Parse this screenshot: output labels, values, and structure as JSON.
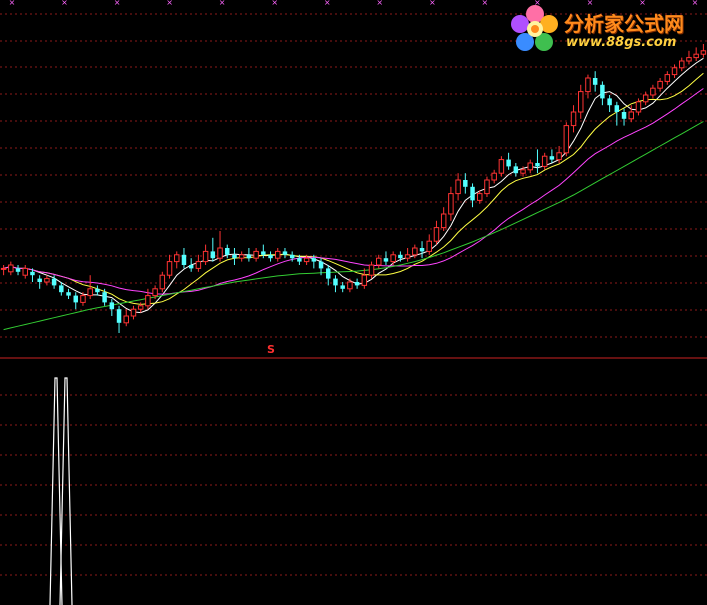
{
  "chart_data": [
    {
      "type": "candlestick",
      "panel": "price",
      "title": "",
      "xlabel": "",
      "ylabel": "",
      "grid": true,
      "candle_count": 98,
      "candles": [
        [
          24,
          24,
          22,
          25
        ],
        [
          23,
          25,
          22,
          26
        ],
        [
          24,
          23,
          22,
          25
        ],
        [
          22,
          24,
          21,
          25
        ],
        [
          23,
          22,
          20,
          24
        ],
        [
          21,
          20,
          18,
          22
        ],
        [
          20,
          21,
          19,
          22
        ],
        [
          21,
          19,
          18,
          22
        ],
        [
          19,
          17,
          16,
          20
        ],
        [
          17,
          16,
          15,
          18
        ],
        [
          16,
          14,
          12,
          17
        ],
        [
          14,
          16,
          13,
          17
        ],
        [
          16,
          18,
          15,
          22
        ],
        [
          18,
          17,
          16,
          19
        ],
        [
          17,
          14,
          13,
          18
        ],
        [
          14,
          12,
          10,
          15
        ],
        [
          12,
          8,
          5,
          13
        ],
        [
          8,
          10,
          7,
          12
        ],
        [
          10,
          12,
          9,
          13
        ],
        [
          12,
          13,
          11,
          14
        ],
        [
          13,
          16,
          12,
          18
        ],
        [
          16,
          18,
          15,
          19
        ],
        [
          18,
          22,
          17,
          23
        ],
        [
          22,
          26,
          21,
          28
        ],
        [
          26,
          28,
          24,
          29
        ],
        [
          28,
          25,
          24,
          30
        ],
        [
          25,
          24,
          23,
          27
        ],
        [
          24,
          26,
          23,
          28
        ],
        [
          26,
          29,
          25,
          31
        ],
        [
          29,
          27,
          26,
          33
        ],
        [
          27,
          30,
          26,
          35
        ],
        [
          30,
          28,
          27,
          31
        ],
        [
          28,
          27,
          25,
          30
        ],
        [
          27,
          28,
          26,
          29
        ],
        [
          28,
          27,
          26,
          30
        ],
        [
          27,
          29,
          26,
          30
        ],
        [
          29,
          28,
          27,
          31
        ],
        [
          28,
          27,
          26,
          29
        ],
        [
          27,
          29,
          26,
          30
        ],
        [
          29,
          28,
          27,
          30
        ],
        [
          28,
          27,
          26,
          29
        ],
        [
          27,
          26,
          25,
          28
        ],
        [
          26,
          27,
          25,
          28
        ],
        [
          27,
          26,
          24,
          28
        ],
        [
          26,
          24,
          22,
          27
        ],
        [
          24,
          21,
          19,
          25
        ],
        [
          21,
          19,
          17,
          22
        ],
        [
          19,
          18,
          17,
          20
        ],
        [
          18,
          20,
          17,
          21
        ],
        [
          20,
          19,
          18,
          21
        ],
        [
          19,
          22,
          18,
          24
        ],
        [
          22,
          25,
          21,
          26
        ],
        [
          25,
          27,
          24,
          28
        ],
        [
          27,
          26,
          25,
          29
        ],
        [
          26,
          28,
          25,
          29
        ],
        [
          28,
          27,
          26,
          29
        ],
        [
          27,
          28,
          26,
          30
        ],
        [
          28,
          30,
          27,
          31
        ],
        [
          30,
          29,
          27,
          32
        ],
        [
          29,
          32,
          28,
          34
        ],
        [
          32,
          36,
          31,
          38
        ],
        [
          36,
          40,
          35,
          42
        ],
        [
          40,
          46,
          38,
          48
        ],
        [
          46,
          50,
          44,
          52
        ],
        [
          50,
          48,
          46,
          52
        ],
        [
          48,
          44,
          42,
          49
        ],
        [
          44,
          46,
          43,
          47
        ],
        [
          46,
          50,
          45,
          51
        ],
        [
          50,
          52,
          49,
          53
        ],
        [
          52,
          56,
          51,
          57
        ],
        [
          56,
          54,
          53,
          58
        ],
        [
          54,
          52,
          51,
          55
        ],
        [
          52,
          53,
          51,
          54
        ],
        [
          53,
          55,
          52,
          56
        ],
        [
          55,
          54,
          52,
          59
        ],
        [
          54,
          57,
          53,
          58
        ],
        [
          57,
          56,
          55,
          59
        ],
        [
          56,
          58,
          55,
          60
        ],
        [
          58,
          66,
          57,
          67
        ],
        [
          66,
          70,
          64,
          72
        ],
        [
          70,
          76,
          68,
          78
        ],
        [
          76,
          80,
          74,
          81
        ],
        [
          80,
          78,
          76,
          82
        ],
        [
          78,
          74,
          72,
          79
        ],
        [
          74,
          72,
          70,
          75
        ],
        [
          72,
          70,
          66,
          73
        ],
        [
          70,
          68,
          66,
          71
        ],
        [
          68,
          70,
          67,
          72
        ],
        [
          70,
          73,
          69,
          74
        ],
        [
          73,
          75,
          72,
          76
        ],
        [
          75,
          77,
          74,
          78
        ],
        [
          77,
          79,
          76,
          80
        ],
        [
          79,
          81,
          78,
          82
        ],
        [
          81,
          83,
          80,
          84
        ],
        [
          83,
          85,
          82,
          86
        ],
        [
          85,
          86,
          84,
          88
        ],
        [
          86,
          87,
          85,
          89
        ],
        [
          87,
          88,
          86,
          90
        ]
      ],
      "ylim": [
        0,
        100
      ],
      "series": [
        {
          "kind": "ma-short",
          "color": "#ffffff",
          "window": 5
        },
        {
          "kind": "ma-mid",
          "color": "#ffff44",
          "window": 10
        },
        {
          "kind": "ma-long",
          "color": "#ff44ff",
          "window": 20
        },
        {
          "kind": "ma-slow",
          "color": "#33cc33",
          "values": [
            6,
            6.5,
            7,
            7.5,
            8,
            8.5,
            9,
            9.5,
            10,
            10.5,
            11,
            11.5,
            12,
            12.4,
            12.8,
            13.2,
            13.6,
            14,
            14.4,
            14.8,
            15.2,
            15.6,
            16,
            16.4,
            16.8,
            17.2,
            17.6,
            18,
            18.4,
            18.8,
            19.2,
            19.6,
            20,
            20.3,
            20.6,
            20.9,
            21.2,
            21.5,
            21.8,
            22,
            22.2,
            22.4,
            22.5,
            22.6,
            22.7,
            22.8,
            22.9,
            23,
            23.1,
            23.2,
            23.4,
            23.6,
            23.9,
            24.2,
            24.6,
            25,
            25.5,
            26,
            26.6,
            27.2,
            27.9,
            28.6,
            29.4,
            30.2,
            31,
            31.8,
            32.7,
            33.6,
            34.5,
            35.4,
            36.4,
            37.4,
            38.4,
            39.4,
            40.4,
            41.4,
            42.4,
            43.4,
            44.5,
            45.6,
            46.8,
            48,
            49.2,
            50.4,
            51.6,
            52.8,
            54,
            55.2,
            56.4,
            57.6,
            58.8,
            60,
            61.2,
            62.4,
            63.6,
            64.8,
            66,
            67.2
          ]
        }
      ],
      "colors": {
        "up": "#ff3333",
        "down": "#54ffff",
        "grid": "#8b1a1a",
        "divider": "#cc2222"
      },
      "top_ticks_count": 14,
      "signal_marker": {
        "index": 37,
        "text": "S",
        "color": "#ff3030"
      }
    },
    {
      "type": "line",
      "panel": "indicator",
      "title": "",
      "xlabel": "",
      "ylabel": "",
      "grid": true,
      "series": [
        {
          "color": "#ffffff",
          "values": [
            0,
            0,
            0,
            0,
            0,
            0,
            0,
            0,
            0,
            0,
            0,
            0,
            0,
            0,
            0,
            0,
            0,
            0,
            0,
            0,
            0,
            0,
            0,
            0,
            0,
            0,
            0,
            0,
            0,
            0,
            0,
            0,
            0,
            0,
            0,
            0,
            0,
            0,
            0,
            0,
            0,
            0,
            0,
            0,
            0,
            0,
            0,
            0,
            0,
            0,
            0,
            0,
            0,
            0,
            0,
            0,
            0,
            0,
            0,
            0,
            0,
            0,
            0,
            0,
            0,
            0,
            0,
            0,
            0,
            0,
            0,
            0,
            0,
            0,
            0,
            0,
            0,
            0,
            0,
            0,
            0,
            0,
            0,
            0,
            0,
            0,
            0,
            0,
            0,
            0,
            0,
            0,
            0,
            0,
            0,
            0,
            0,
            0
          ]
        }
      ],
      "spike_peaks": [
        {
          "index": 8,
          "value": 100
        },
        {
          "index": 9,
          "value": 100
        }
      ],
      "ylim": [
        0,
        100
      ]
    }
  ],
  "logo": {
    "title": "分析家公式网",
    "url": "www.88gs.com"
  },
  "signal_label": "S"
}
